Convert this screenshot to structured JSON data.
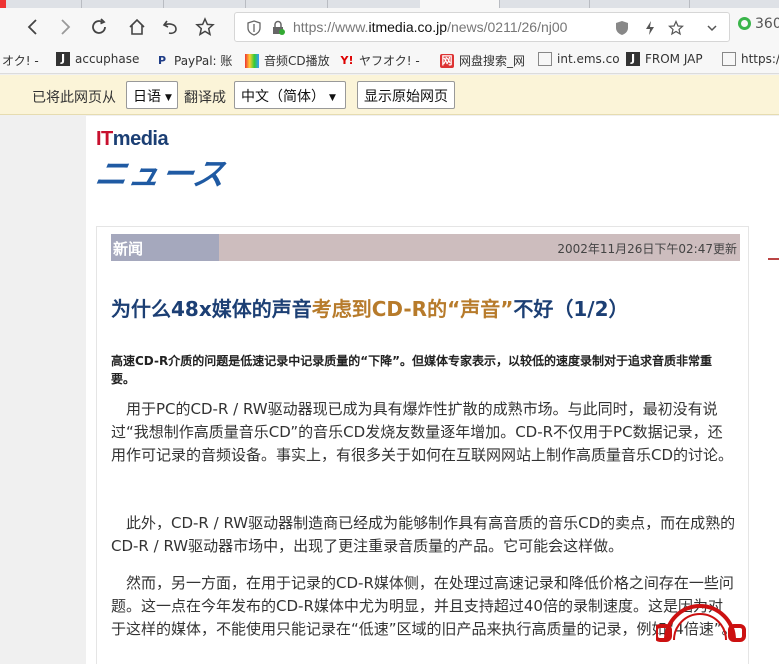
{
  "browser": {
    "url_prefix": "https://www.",
    "url_domain": "itmedia.co.jp",
    "url_path": "/news/0211/26/nj00",
    "extension_label": "360"
  },
  "bookmarks": [
    {
      "icon": "",
      "label": "オク! -"
    },
    {
      "icon": "accuphase-favicon",
      "label": "accuphase"
    },
    {
      "icon": "paypal-favicon",
      "label": "PayPal: 账"
    },
    {
      "icon": "cd-favicon",
      "label": "音频CD播放"
    },
    {
      "icon": "yahoo-favicon",
      "label": "ヤフオク! -"
    },
    {
      "icon": "netdisk-favicon",
      "label": "网盘搜索_网"
    },
    {
      "icon": "page-favicon",
      "label": "int.ems.co"
    },
    {
      "icon": "j-favicon",
      "label": "FROM JAP"
    },
    {
      "icon": "page-favicon",
      "label": "https:/"
    }
  ],
  "translate": {
    "prefix": "已将此网页从",
    "source_lang": "日语",
    "middle": "翻译成",
    "target_lang": "中文（简体）",
    "show_original": "显示原始网页"
  },
  "page": {
    "logo_it_i": "IT",
    "logo_media": "media",
    "logo_news": "ニュース",
    "section_tag": "新闻",
    "updated": "2002年11月26日下午02:47更新",
    "title_part1": "为什么48x媒体的声音",
    "title_part2": "考虑到CD-R的“声音”",
    "title_part3": "不好（1/2）",
    "lead": "高速CD-R介质的问题是低速记录中记录质量的“下降”。但媒体专家表示，以较低的速度录制对于追求音质非常重要。",
    "paragraphs": [
      "用于PC的CD-R / RW驱动器现已成为具有爆炸性扩散的成熟市场。与此同时，最初没有说过“我想制作高质量音乐CD”的音乐CD发烧友数量逐年增加。CD-R不仅用于PC数据记录，还用作可记录的音频设备。事实上，有很多关于如何在互联网网站上制作高质量音乐CD的讨论。",
      "此外，CD-R / RW驱动器制造商已经成为能够制作具有高音质的音乐CD的卖点，而在成熟的CD-R / RW驱动器市场中，出现了更注重录音质量的产品。它可能会这样做。",
      "然而，另一方面，在用于记录的CD-R媒体侧，在处理过高速记录和降低价格之间存在一些问题。这一点在今年发布的CD-R媒体中尤为明显，并且支持超过40倍的录制速度。这是因为对于这样的媒体，不能使用只能记录在“低速”区域的旧产品来执行高质量的记录，例如“4倍速”。"
    ]
  }
}
